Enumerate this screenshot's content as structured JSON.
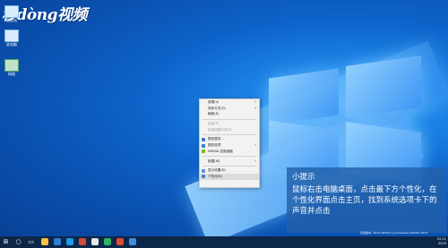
{
  "watermark": {
    "text": "秒dòng视频"
  },
  "desktop_icons": [
    {
      "label": "回收站"
    },
    {
      "label": "此电脑"
    },
    {
      "label": "网络"
    }
  ],
  "context_menu": {
    "items": [
      {
        "label": "查看(V)",
        "submenu": true
      },
      {
        "label": "排序方式(O)",
        "submenu": true
      },
      {
        "label": "刷新(E)"
      },
      {
        "label": "粘贴(P)",
        "disabled": true
      },
      {
        "label": "粘贴快捷方式(S)",
        "disabled": true
      },
      {
        "label": "图形属性..."
      },
      {
        "label": "图形选项",
        "submenu": true
      },
      {
        "label": "NVIDIA 控制面板"
      },
      {
        "label": "新建(W)",
        "submenu": true
      },
      {
        "label": "显示设置(D)"
      },
      {
        "label": "个性化(R)"
      }
    ]
  },
  "tooltip": {
    "title": "小提示",
    "body": "鼠标右击电脑桌面，点击最下方个性化，在个性化界面点击主页，找到系统选项卡下的声音并点击"
  },
  "build_info": "评估副本。Build 18334.rs_prerelease.190301-1502",
  "clock": {
    "time": "22:11",
    "date": "2019"
  },
  "colors": {
    "taskbar": "#0d2748",
    "tooltip_bg": "#2260aa",
    "menu_bg": "#f2f2f2"
  }
}
